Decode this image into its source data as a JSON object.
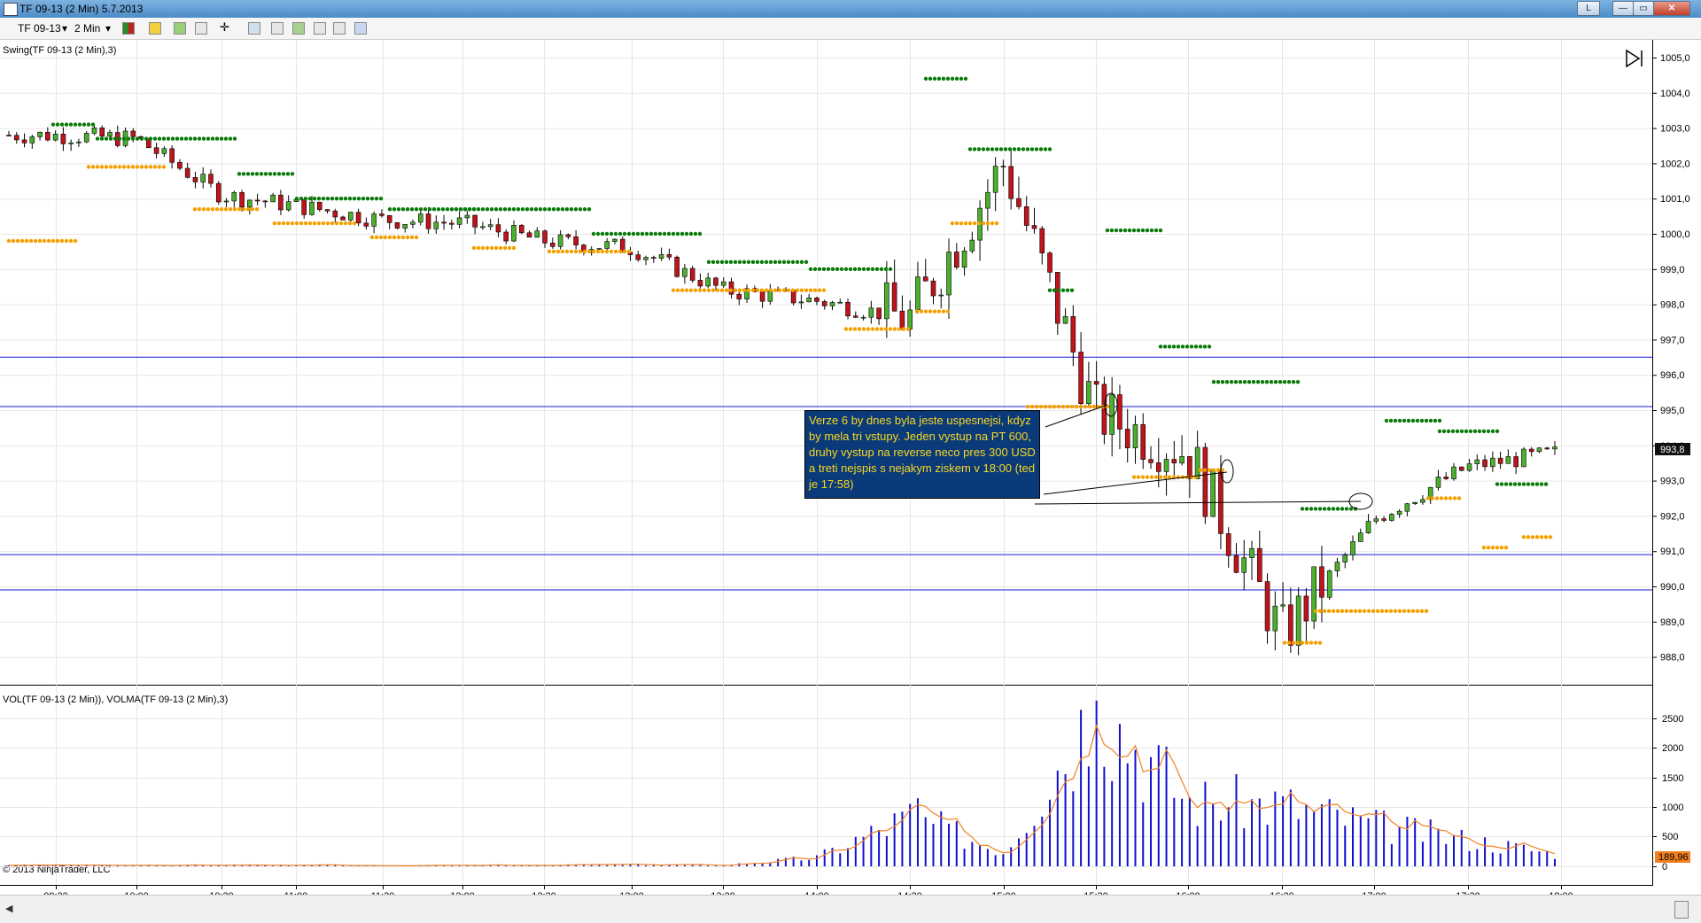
{
  "window": {
    "title": "TF 09-13 (2 Min)  5.7.2013",
    "buttons": {
      "l": "L",
      "minimize": "—",
      "maximize": "▭",
      "close": "✕"
    }
  },
  "toolbar": {
    "instrument": "TF 09-13",
    "interval": "2 Min",
    "icons": [
      "bar-style-icon",
      "draw-icon",
      "add-indicator-icon",
      "strategy-icon",
      "crosshair-icon",
      "zoom-icon",
      "properties-icon",
      "data-box-icon",
      "chart-trader-icon",
      "templates-icon",
      "layout-icon"
    ]
  },
  "price_panel": {
    "indicator_label": "Swing(TF 09-13 (2 Min),3)",
    "y_ticks": [
      "1005,0",
      "1004,0",
      "1003,0",
      "1002,0",
      "1001,0",
      "1000,0",
      "999,0",
      "998,0",
      "997,0",
      "996,0",
      "995,0",
      "994,0",
      "993,0",
      "992,0",
      "991,0",
      "990,0",
      "989,0",
      "988,0"
    ],
    "last_price": "993,8",
    "last_price_color": "#ffffff",
    "horizontal_lines": [
      996.5,
      995.1,
      990.9,
      989.9
    ],
    "line_color": "#1a1adc",
    "annotation": "Verze 6 by dnes byla jeste uspesnejsi, kdyz by mela tri vstupy. Jeden vystup na PT 600, druhy vystup na reverse neco pres 300 USD a treti nejspis s nejakym ziskem v 18:00 (ted je 17:58)",
    "annotation_bg": "#0b3a7a",
    "annotation_color": "#f8d820",
    "up_color": "#4caf2e",
    "down_color": "#c0141c",
    "swing_high_color": "#0a7a0a",
    "swing_low_color": "#f5a000"
  },
  "volume_panel": {
    "indicator_label": "VOL(TF 09-13 (2 Min)), VOLMA(TF 09-13 (2 Min),3)",
    "y_ticks": [
      "2500",
      "2000",
      "1500",
      "1000",
      "500",
      "0"
    ],
    "last_volma": "189,96",
    "bar_color": "#1010d0",
    "ma_color": "#f08020"
  },
  "x_axis": {
    "ticks": [
      "09:30",
      "10:00",
      "10:30",
      "11:00",
      "11:30",
      "12:00",
      "12:30",
      "13:00",
      "13:30",
      "14:00",
      "14:30",
      "15:00",
      "15:30",
      "16:00",
      "16:30",
      "17:00",
      "17:30",
      "18:00"
    ]
  },
  "copyright": "© 2013 NinjaTrader, LLC",
  "chart_data": {
    "type": "candlestick",
    "title": "TF 09-13 (2 Min)  5.7.2013",
    "x": [
      "09:30",
      "10:00",
      "10:30",
      "11:00",
      "11:30",
      "12:00",
      "12:30",
      "13:00",
      "13:30",
      "14:00",
      "14:30",
      "15:00",
      "15:30",
      "16:00",
      "16:30",
      "17:00",
      "17:30",
      "18:00"
    ],
    "close": [
      1002.8,
      1002.7,
      1001.1,
      1000.8,
      1000.4,
      1000.3,
      999.8,
      999.6,
      998.4,
      998.1,
      997.6,
      1002.0,
      994.9,
      993.8,
      988.6,
      991.9,
      993.4,
      993.8
    ],
    "ylim": [
      987.5,
      1005.2
    ],
    "volume": [
      20,
      15,
      20,
      25,
      10,
      15,
      20,
      30,
      20,
      150,
      850,
      250,
      2800,
      1100,
      1050,
      700,
      450,
      200
    ],
    "volume_ylim": [
      0,
      2800
    ]
  }
}
